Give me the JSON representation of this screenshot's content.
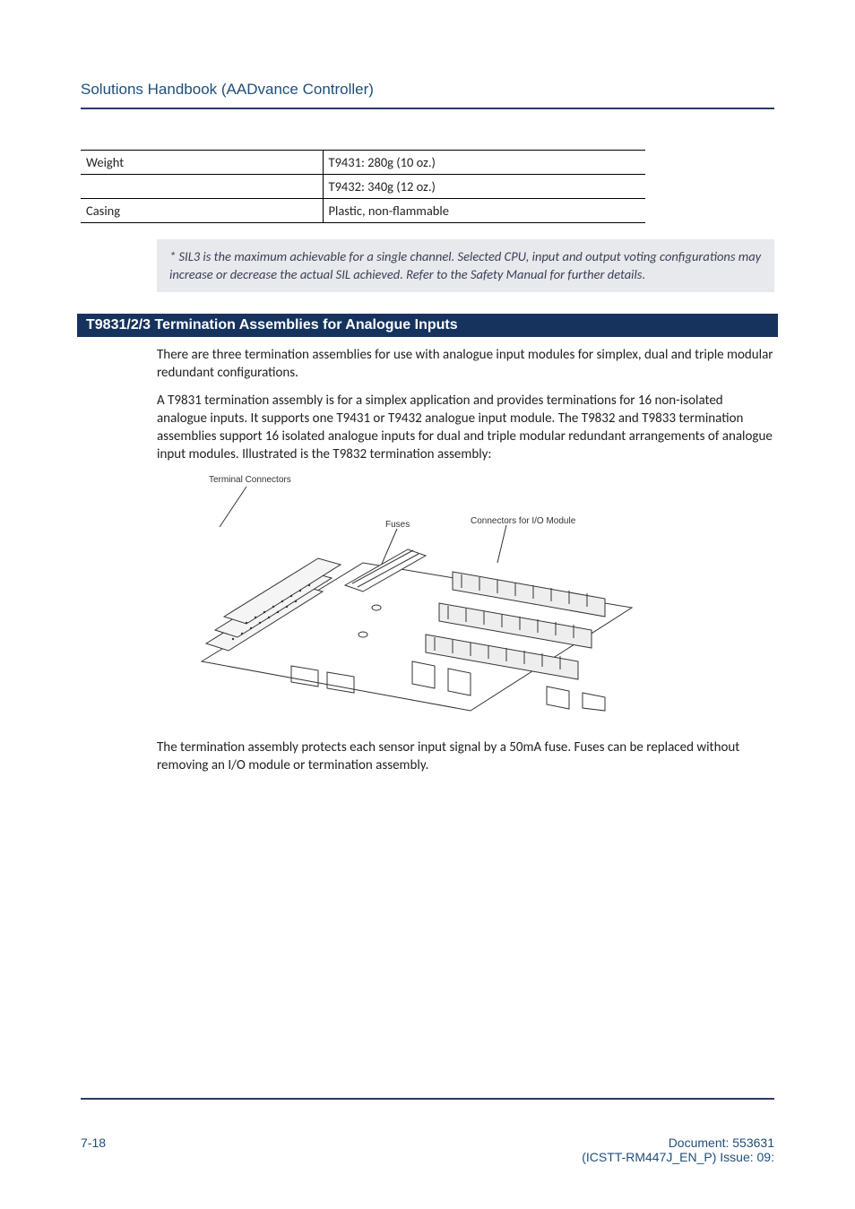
{
  "header": {
    "title": "Solutions Handbook (AADvance Controller)"
  },
  "spec_table": {
    "rows": [
      {
        "label": "Weight",
        "value1": "T9431: 280g (10 oz.)",
        "value2": "T9432: 340g (12 oz.)"
      },
      {
        "label": "Casing",
        "value1": "Plastic, non-flammable"
      }
    ]
  },
  "note": "* SIL3 is the maximum achievable for a single channel. Selected CPU, input and output voting configurations may increase or decrease the actual SIL achieved. Refer to the Safety Manual for further details.",
  "section": {
    "banner": "T9831/2/3 Termination Assemblies for Analogue Inputs",
    "para1": "There are three termination assemblies for use with analogue input modules for simplex, dual and triple modular redundant configurations.",
    "para2": "A T9831 termination assembly is for a simplex application and provides terminations for 16 non-isolated analogue inputs. It supports one T9431 or T9432 analogue input module. The T9832 and T9833 termination assemblies support 16 isolated analogue inputs for dual and triple modular redundant arrangements of analogue input modules. Illustrated is the T9832 termination assembly:",
    "para3": "The termination assembly protects each sensor input signal by a 50mA fuse. Fuses can be replaced without removing an I/O module or termination assembly."
  },
  "diagram": {
    "label_terminal": "Terminal Connectors",
    "label_fuses": "Fuses",
    "label_io": "Connectors for I/O Module"
  },
  "footer": {
    "page": "7-18",
    "doc": "Document: 553631",
    "issue": "(ICSTT-RM447J_EN_P) Issue: 09:"
  }
}
